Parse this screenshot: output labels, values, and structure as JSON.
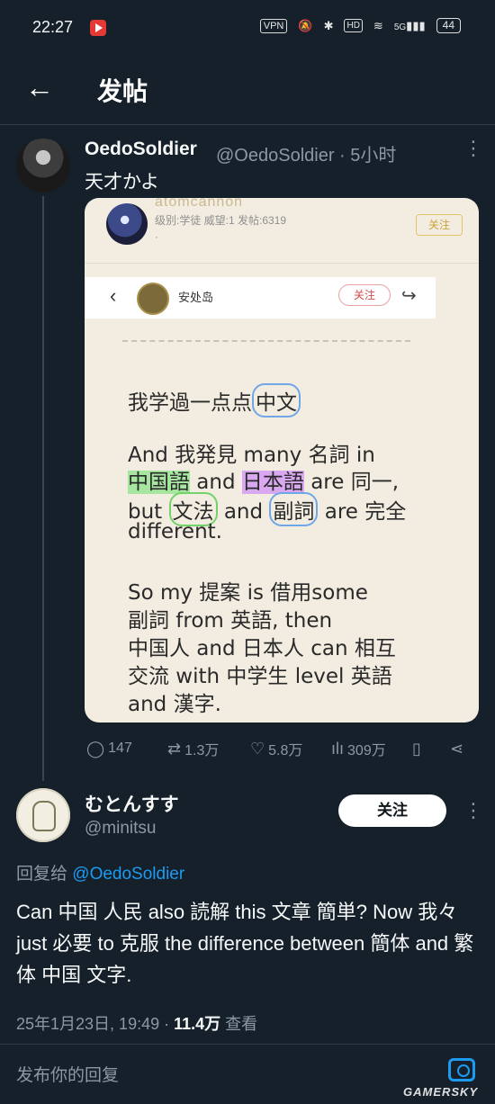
{
  "status_bar": {
    "time": "22:27",
    "vpn": "VPN",
    "hd": "HD",
    "signal_label": "5G",
    "battery": "44",
    "icons": [
      "record-icon",
      "mute-icon",
      "bluetooth-icon",
      "wifi-icon",
      "signal-icon",
      "battery-icon"
    ]
  },
  "header": {
    "title": "发帖"
  },
  "tweet": {
    "display_name": "OedoSoldier",
    "handle_time": "@OedoSoldier · 5小时",
    "text": "天才かよ",
    "image": {
      "username": "atomcannon",
      "meta": "级别:学徒 威望:1 发帖:6319",
      "dot": "·",
      "follow_label": "关注",
      "inner_name": "安处岛",
      "inner_follow": "关注",
      "line1_a": "我学過一点点",
      "line1_b": "中文",
      "line2": "And 我発見 many 名詞 in",
      "line3_a": "中国語",
      "line3_b": " and ",
      "line3_c": "日本語",
      "line3_d": " are 同一,",
      "line4_a": "but ",
      "line4_b": "文法",
      "line4_c": " and ",
      "line4_d": "副詞",
      "line4_e": " are  完全",
      "line5": " different.",
      "line6": "So my 提案 is 借用some",
      "line7": "副詞 from 英語, then",
      "line8": "中国人 and 日本人 can 相互",
      "line9": "交流 with 中学生 level 英語",
      "line10": "and 漢字."
    },
    "stats": {
      "replies": "147",
      "retweets": "1.3万",
      "likes": "5.8万",
      "views": "309万"
    }
  },
  "reply": {
    "display_name": "むとんすす",
    "handle": "@minitsu",
    "follow_label": "关注",
    "reply_prefix": "回复给 ",
    "reply_mention": "@OedoSoldier",
    "body": "Can 中国 人民 also 読解 this 文章 簡単? Now 我々 just 必要 to 克服 the difference between 簡体 and 繁体 中国 文字.",
    "date": "25年1月23日, 19:49 · ",
    "views_count": "11.4万",
    "views_label": " 查看"
  },
  "composer": {
    "placeholder": "发布你的回复"
  },
  "watermark": "GAMERSKY"
}
